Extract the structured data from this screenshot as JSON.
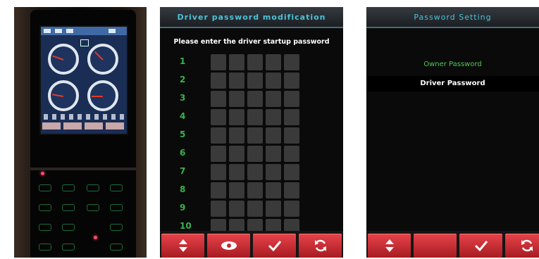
{
  "photo": {
    "subject_icon": "device-photo"
  },
  "driver_password_screen": {
    "title": "Driver password modification",
    "prompt": "Please enter the driver startup password",
    "row_numbers": [
      "1",
      "2",
      "3",
      "4",
      "5",
      "6",
      "7",
      "8",
      "9",
      "10"
    ],
    "softkeys": [
      {
        "icon": "up-down-arrows-icon"
      },
      {
        "icon": "eye-icon"
      },
      {
        "icon": "checkmark-icon"
      },
      {
        "icon": "refresh-icon"
      }
    ]
  },
  "password_setting_screen": {
    "title": "Password Setting",
    "menu": [
      {
        "label": "Owner Password",
        "state": "unselected"
      },
      {
        "label": "Driver Password",
        "state": "selected"
      }
    ],
    "softkeys": [
      {
        "icon": "up-down-arrows-icon"
      },
      {
        "icon": "blank"
      },
      {
        "icon": "checkmark-icon"
      },
      {
        "icon": "refresh-icon"
      }
    ]
  },
  "colors": {
    "title_text": "#4cc2d8",
    "softkey_red": "#d9333b",
    "row_number_green": "#3ed25a",
    "selected_menu_green": "#4fc857"
  }
}
